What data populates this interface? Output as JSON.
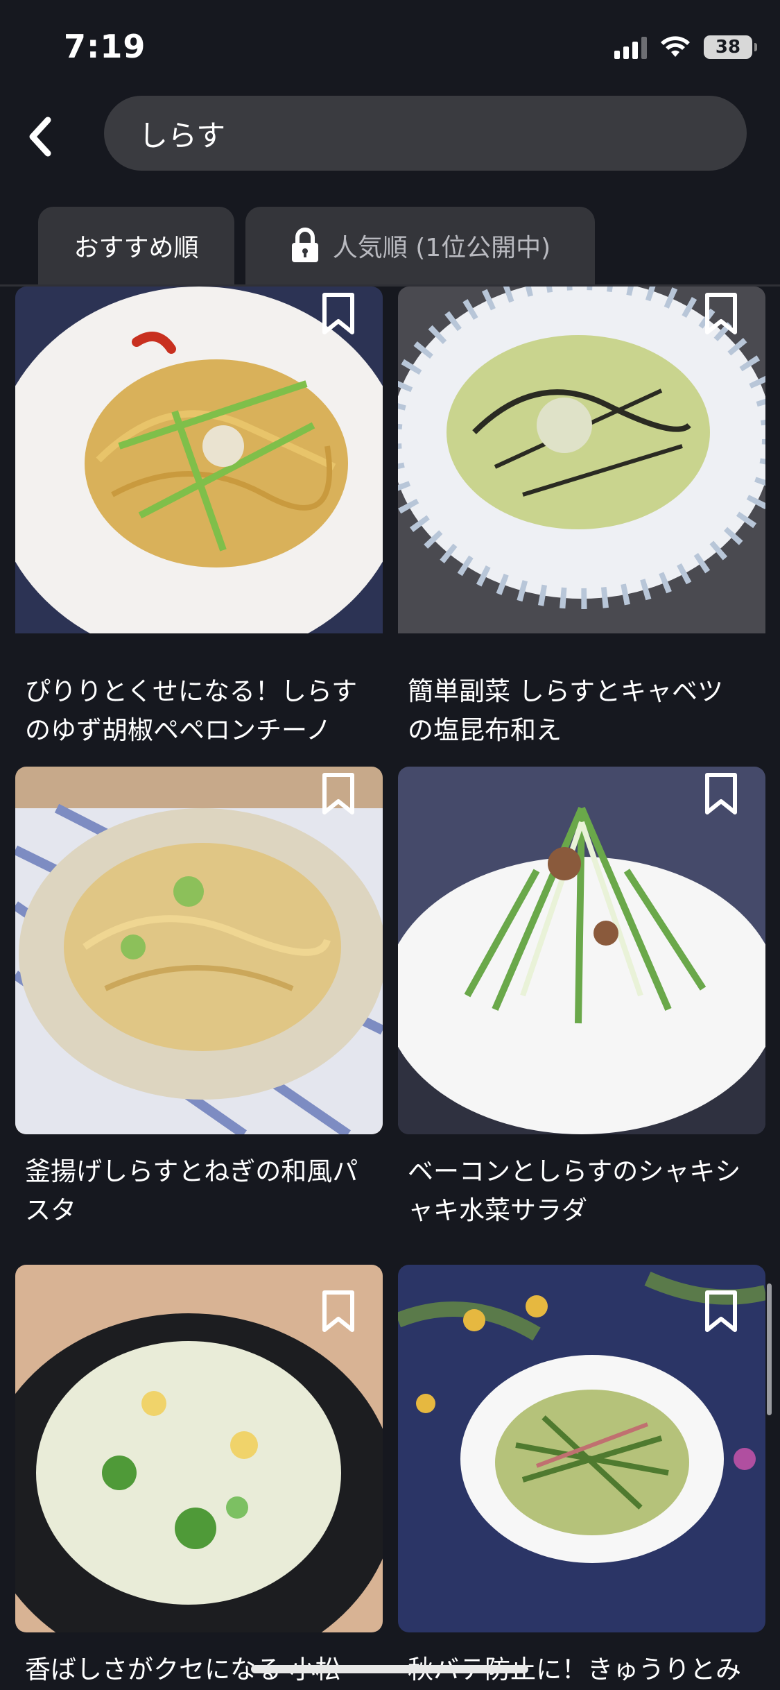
{
  "status_bar": {
    "time": "7:19",
    "battery": "38"
  },
  "search": {
    "query": "しらす"
  },
  "tabs": [
    {
      "label": "おすすめ順",
      "selected": true
    },
    {
      "label": "人気順 (1位公開中)",
      "locked": true
    }
  ],
  "recipes": [
    {
      "title": "ぴりりとくせになる！しらすのゆず胡椒ペペロンチーノ",
      "image_icon": "pasta-dish-icon"
    },
    {
      "title": "簡単副菜 しらすとキャベツの塩昆布和え",
      "image_icon": "cabbage-salad-icon"
    },
    {
      "title": "釜揚げしらすとねぎの和風パスタ",
      "image_icon": "pasta-dish-icon"
    },
    {
      "title": "ベーコンとしらすのシャキシャキ水菜サラダ",
      "image_icon": "mizuna-salad-icon"
    },
    {
      "title": "香ばしさがクセになる 小松菜",
      "image_icon": "fried-rice-icon"
    },
    {
      "title": "秋バテ防止に！きゅうりとみ",
      "image_icon": "cucumber-salad-icon"
    }
  ],
  "colors": {
    "background": "#16181f",
    "surface": "#3a3b40",
    "tab": "#34353a",
    "text": "#ffffff",
    "muted_text": "#b9bac0"
  }
}
